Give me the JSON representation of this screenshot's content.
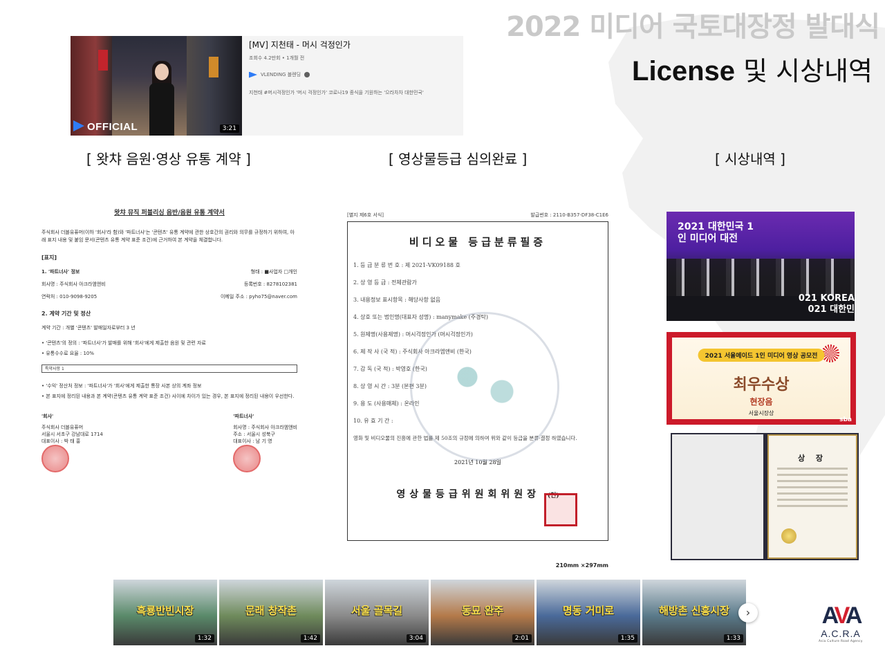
{
  "header": {
    "event_title": "2022 미디어 국토대장정 발대식",
    "section_title_en": "License",
    "section_title_ko": "및 시상내역"
  },
  "video_card": {
    "title": "[MV] 지천태 - 머시 걱정인가",
    "meta": "조회수 4.2만회 • 1개월 전",
    "channel": "VLENDING 블렌딩",
    "description": "지천태 #머시걱정인가 '머시 걱정인가' 코로나19 종식을 기원하는 '으라차차 대한민국'",
    "thumb_badge": "OFFICIAL",
    "duration": "3:21"
  },
  "captions": {
    "contract": "[ 왓챠 음원·영상 유통 계약 ]",
    "rating": "[ 영상물등급 심의완료 ]",
    "awards": "[ 시상내역 ]"
  },
  "contract_doc": {
    "title": "왓챠 뮤직 퍼블리싱 음반/음원 유통 계약서",
    "intro": "주식회사 더블유퓨머(이하 '회사'라 함)와 '파트너사'는 '콘텐츠' 유통 계약에 관한 상호간의 권리와 의무를 규정하기 위하여, 아래 표지 내용 및 붙임 문서(콘텐츠 유통 계약 표준 조건)에 근거하여 본 계약을 체결합니다.",
    "cover": "[표지]",
    "section1": "1. '파트너사' 정보",
    "type_label": "형태 :",
    "type_biz": "■사업자",
    "type_person": "□개인",
    "company": "회사명 : 주식회사 아크라엠앤비",
    "reg_no": "등록번호 : 8278102381",
    "contact": "연락처 : 010-9098-9205",
    "email": "이메일 주소 : pyho75@naver.com",
    "section2": "2. 계약 기간 및 정산",
    "period": "계약 기간 : 개별 '콘텐츠' 발매일자로부터 3 년",
    "content_def": "• '콘텐츠'의 정의 : '파트너사'가 발매를 위해 '회사'에게 제출한 음원 및 관련 자료",
    "fee": "• 유통수수료 요율 : 10%",
    "special": "특약사항 1",
    "income": "• '수익' 정산처 정보 : '파트너사'가 '회사'에게 제출한 통장 사본 상의 계좌 정보",
    "conflict": "• 본 표지에 정리된 내용과 본 계약(콘텐츠 유통 계약 표준 조건) 사이에 차이가 있는 경우, 본 표지에 정리된 내용이 우선한다.",
    "co_label": "'회사'",
    "co_name": "주식회사 더블유퓨머",
    "co_addr": "서울시 서초구 강남대로 1714",
    "co_ceo": "대표이사 : 박 태 홍",
    "pt_label": "'파트너사'",
    "pt_name": "회사명 : 주식회사 아크라엠앤비",
    "pt_addr": "주소 : 서울시 성북구",
    "pt_ceo": "대표이사 : 남 기 영"
  },
  "rating_doc": {
    "form_no": "[별지 제6호 서식]",
    "issue_no": "발급번호 : 2110-B357-DF38-C1E6",
    "title": "비디오물 등급분류필증",
    "items": [
      "1. 등 급 분 류 번 호 : 제 2021-VK09188 호",
      "2. 상  영  등  급 : 전체관람가",
      "3. 내용정보 표시항목 : 해당사항 없음",
      "4. 상호 또는 법인명(대표자 성명) : manymake (주경탁)",
      "5. 원제명(사용제명) : 머시걱정인가 (머시걱정인가)",
      "6. 제  작  사 (국 적) : 주식회사 아크라엠앤비 (한국)",
      "7. 감  독 (국 적) : 박영호 (한국)",
      "8. 상  영  시  간 : 3분 (본편 3분)",
      "9. 용  도 (사용매체) : 온라인",
      "10. 유  효  기  간 :"
    ],
    "note": "영화 및 비디오물의 진흥에 관한 법률 제 50조의 규정에 의하여 위와 같이 등급을 분류·결정 하였습니다.",
    "date": "2021년 10월 28일",
    "issuer": "영상물등급위원회위원장",
    "seal_text": "(인)",
    "size": "210mm ×297mm"
  },
  "awards": {
    "photo1_banner": "2021 대한민국 1인 미디어 대전",
    "photo1_banner_sub": "021 KOREA 021 대한민",
    "photo2_pill": "2021 서울메이드 1인 미디어 영상 공모전",
    "photo2_best": "최우수상",
    "photo2_prize": "현장음",
    "photo2_mayor": "서울시장상",
    "photo2_logo": "sba",
    "photo3_title": "상 장"
  },
  "strip": [
    {
      "label": "흑룡반빈시장",
      "duration": "1:32",
      "color": "#5a8a6a"
    },
    {
      "label": "문래 창작촌",
      "duration": "1:42",
      "color": "#6f8b5c"
    },
    {
      "label": "서울 골목길",
      "duration": "3:04",
      "color": "#8a8a8a"
    },
    {
      "label": "동묘 완주",
      "duration": "2:01",
      "color": "#b47a4a"
    },
    {
      "label": "명동 거미로",
      "duration": "1:35",
      "color": "#4a6a9a"
    },
    {
      "label": "해방촌 신흥시장",
      "duration": "1:33",
      "color": "#5a7a8a"
    }
  ],
  "strip_next": "›",
  "logo": {
    "mark_a": "A",
    "mark_v": "V",
    "mark_a2": "A",
    "name": "A.C.R.A",
    "tagline": "Asia Culture Road Agency"
  }
}
